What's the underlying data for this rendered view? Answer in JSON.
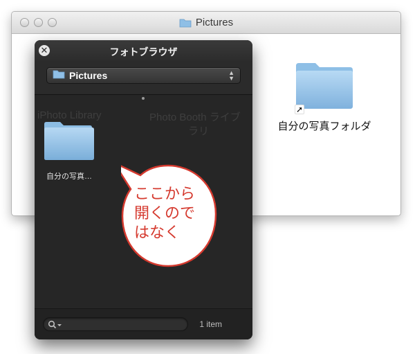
{
  "finder": {
    "title": "Pictures",
    "items": [
      {
        "label": "自分の写真フォルダ",
        "icon": "folder-alias-icon"
      }
    ]
  },
  "photo_browser": {
    "title": "フォトブラウザ",
    "source": {
      "selected": "Pictures"
    },
    "background_labels": [
      "iPhoto Library",
      "Photo Booth ライブ",
      "ラリ"
    ],
    "content": {
      "folders": [
        {
          "label": "自分の写真…",
          "icon": "folder-icon"
        }
      ]
    },
    "search": {
      "placeholder": ""
    },
    "status": {
      "item_count": "1 item"
    }
  },
  "annotation": {
    "lines": [
      "ここから",
      "開くので",
      "はなく"
    ]
  },
  "colors": {
    "hud_background": "#262626",
    "annotation_red": "#d53a2f",
    "folder_blue": "#8fbfe6"
  }
}
